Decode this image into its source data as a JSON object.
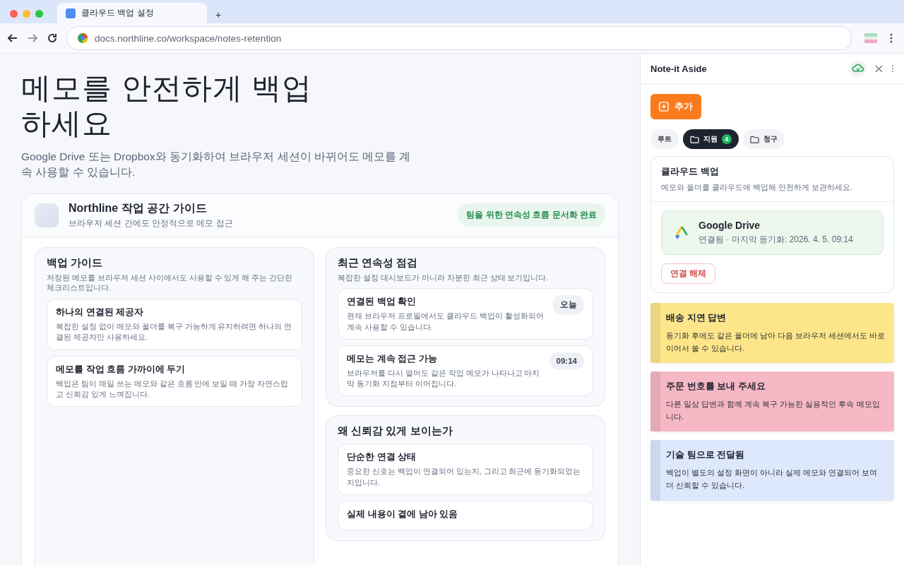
{
  "browser": {
    "tab_title": "클라우드 백업 설정",
    "new_tab": "+",
    "url": "docs.northline.co/workspace/notes-retention"
  },
  "page": {
    "title": "메모를 안전하게 백업\n하세요",
    "intro": "Google Drive 또는 Dropbox와 동기화하여 브라우저 세션이 바뀌어도 메모를 계속 사용할 수 있습니다.",
    "guide": {
      "title": "Northline 작업 공간 가이드",
      "subtitle": "브라우저 세션 간에도 안정적으로 메모 접근",
      "badge": "팀을 위한 연속성 흐름 문서화 완료"
    },
    "sections": [
      {
        "title": "백업 가이드",
        "desc": "저장된 메모를 브라우저 세션 사이에서도 사용할 수 있게 해 주는 간단한 체크리스트입니다.",
        "items": [
          {
            "title": "하나의 연결된 제공자",
            "text": "복잡한 설정 없이 메모와 폴더를 복구 가능하게 유지하려면 하나의 연결된 제공자만 사용하세요."
          },
          {
            "title": "메모를 작업 흐름 가까이에 두기",
            "text": "백업은 팀이 매일 쓰는 메모와 같은 흐름 안에 보일 때 가장 자연스럽고 신뢰감 있게 느껴집니다."
          }
        ]
      },
      {
        "title": "최근 연속성 점검",
        "desc": "복잡한 설정 대시보드가 아니라 차분한 최근 상태 보기입니다.",
        "items": [
          {
            "title": "연결된 백업 확인",
            "text": "현재 브라우저 프로필에서도 클라우드 백업이 활성화되어 계속 사용할 수 있습니다.",
            "tag": "오늘"
          },
          {
            "title": "메모는 계속 접근 가능",
            "text": "브라우저를 다시 열어도 같은 작업 메모가 나타나고 마지막 동기화 지점부터 이어집니다.",
            "tag": "09:14"
          }
        ]
      },
      {
        "title": "왜 신뢰감 있게 보이는가",
        "items": [
          {
            "title": "단순한 연결 상태",
            "text": "중요한 신호는 백업이 연결되어 있는지, 그리고 최근에 동기화되었는지입니다."
          },
          {
            "title": "실제 내용이 곁에 남아 있음"
          }
        ]
      }
    ]
  },
  "panel": {
    "title": "Note-it Aside",
    "add_button": "추가",
    "folders": [
      {
        "label": "루트",
        "selected": false,
        "kind": "root"
      },
      {
        "label": "지원",
        "selected": true,
        "kind": "folder",
        "count": "4"
      },
      {
        "label": "청구",
        "selected": false,
        "kind": "folder"
      }
    ],
    "backup": {
      "title": "클라우드 백업",
      "desc": "메모와 폴더를 클라우드에 백업해 안전하게 보관하세요.",
      "provider": "Google Drive",
      "status": "연결됨 · 마지막 동기화: 2026. 4. 5. 09:14",
      "disconnect": "연결 해제"
    },
    "notes": [
      {
        "title": "배송 지연 답변",
        "text": "동기화 후에도 같은 폴더에 남아 다음 브라우저 세션에서도 바로 이어서 쓸 수 있습니다.",
        "color": "#fde68a"
      },
      {
        "title": "주문 번호를 보내 주세요",
        "text": "다른 일상 답변과 함께 계속 복구 가능한 실용적인 후속 메모입니다.",
        "color": "#f5b8c4"
      },
      {
        "title": "기술 팀으로 전달됨",
        "text": "백업이 별도의 설정 화면이 아니라 실제 메모와 연결되어 보여 더 신뢰할 수 있습니다.",
        "color": "#dde8fd"
      }
    ]
  }
}
